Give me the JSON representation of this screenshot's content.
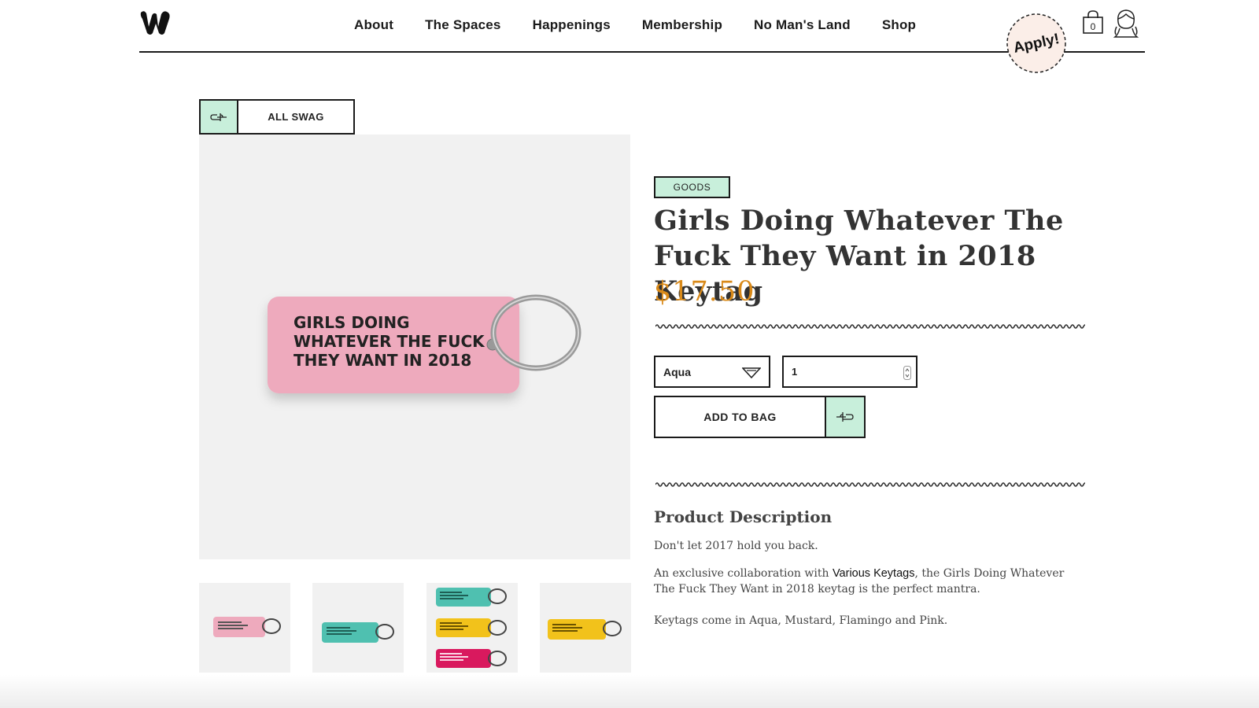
{
  "header": {
    "nav": [
      "About",
      "The Spaces",
      "Happenings",
      "Membership",
      "No Man's Land",
      "Shop"
    ],
    "apply_label": "Apply!",
    "bag_count": "0"
  },
  "back": {
    "label": "ALL SWAG"
  },
  "product": {
    "category": "GOODS",
    "title": "Girls Doing Whatever The Fuck They Want in 2018 Keytag",
    "price": "$17.50",
    "image_text": [
      "GIRLS DOING",
      "WHATEVER THE FUCK",
      "THEY WANT IN 2018"
    ],
    "color_selected": "Aqua",
    "quantity": "1",
    "add_label": "ADD TO BAG"
  },
  "description": {
    "heading": "Product Description",
    "p1": "Don't let 2017 hold you back.",
    "p2_before": "An exclusive collaboration with ",
    "p2_link": "Various Keytags",
    "p2_after": ", the Girls Doing Whatever The Fuck They Want in 2018 keytag is the perfect mantra.",
    "p3": "Keytags come in Aqua, Mustard, Flamingo and Pink."
  },
  "colors": {
    "accent_green": "#c8efdb",
    "price_orange": "#d98a1a",
    "keytag_pink": "#eeaabd",
    "keytag_aqua": "#4fc0b0",
    "keytag_mustard": "#f2c21b",
    "keytag_magenta": "#d9195e"
  },
  "icons": {
    "logo": "w-logo-icon",
    "bag": "shopping-bag-icon",
    "user": "user-avatar-icon",
    "back": "pointing-hand-left-icon",
    "add": "pointing-hand-right-icon",
    "caret": "chevron-down-icon"
  }
}
